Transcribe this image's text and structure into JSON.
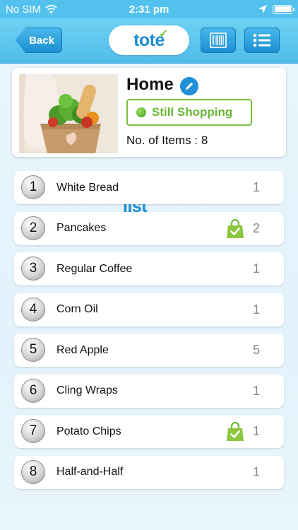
{
  "status_bar": {
    "carrier": "No SIM",
    "time": "2:31 pm"
  },
  "nav": {
    "back_label": "Back",
    "logo_part1": "tote",
    "logo_part2": "list"
  },
  "header": {
    "title": "Home",
    "status": "Still Shopping",
    "items_label": "No. of Items : ",
    "items_count": "8"
  },
  "items": [
    {
      "number": "1",
      "name": "White Bread",
      "qty": "1",
      "in_bag": false
    },
    {
      "number": "2",
      "name": "Pancakes",
      "qty": "2",
      "in_bag": true
    },
    {
      "number": "3",
      "name": "Regular Coffee",
      "qty": "1",
      "in_bag": false
    },
    {
      "number": "4",
      "name": "Corn Oil",
      "qty": "1",
      "in_bag": false
    },
    {
      "number": "5",
      "name": "Red Apple",
      "qty": "5",
      "in_bag": false
    },
    {
      "number": "6",
      "name": "Cling Wraps",
      "qty": "1",
      "in_bag": false
    },
    {
      "number": "7",
      "name": "Potato Chips",
      "qty": "1",
      "in_bag": true
    },
    {
      "number": "8",
      "name": "Half-and-Half",
      "qty": "1",
      "in_bag": false
    }
  ],
  "colors": {
    "accent_blue": "#1f8fd6",
    "header_blue": "#53c1ee",
    "shopping_green": "#7bc043"
  },
  "icons": {
    "wifi": "wifi-icon",
    "location": "location-arrow-icon",
    "battery": "battery-icon",
    "barcode": "barcode-icon",
    "list": "list-icon",
    "edit": "pencil-icon",
    "bag": "shopping-bag-check-icon"
  }
}
